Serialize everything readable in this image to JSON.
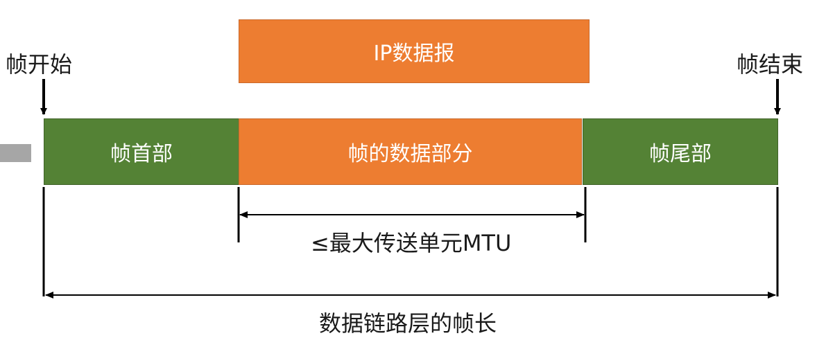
{
  "diagram": {
    "frame_start_label": "帧开始",
    "frame_end_label": "帧结束",
    "ip_datagram_label": "IP数据报",
    "frame_header_label": "帧首部",
    "frame_data_label": "帧的数据部分",
    "frame_trailer_label": "帧尾部",
    "mtu_label": "≤最大传送单元MTU",
    "frame_length_label": "数据链路层的帧长",
    "colors": {
      "green": "#548235",
      "orange": "#ed7d31",
      "line": "#000000"
    }
  }
}
